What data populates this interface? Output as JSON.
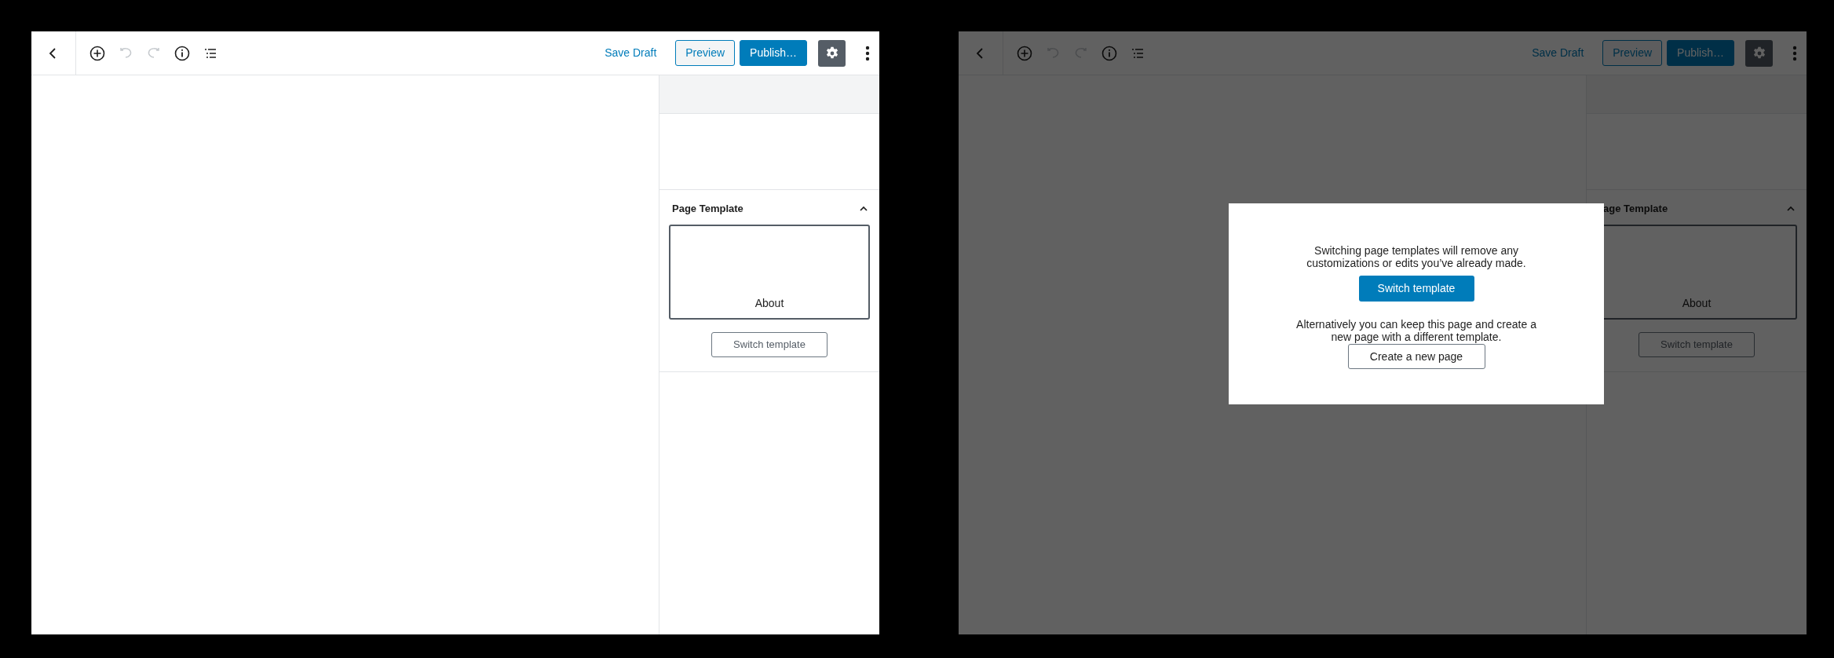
{
  "editors": [
    {
      "dimmed": false,
      "toolbar": {
        "tools": [
          {
            "kind": "back",
            "disabled": false
          },
          {
            "kind": "add",
            "disabled": false
          },
          {
            "kind": "undo",
            "disabled": true
          },
          {
            "kind": "redo",
            "disabled": true
          },
          {
            "kind": "info",
            "disabled": false
          },
          {
            "kind": "outline",
            "disabled": false
          }
        ],
        "save_draft": "Save Draft",
        "preview": "Preview",
        "publish": "Publish…",
        "settings": {
          "selected": true
        }
      },
      "sidebar": {
        "panel": {
          "title": "Page Template",
          "expanded": true,
          "template": {
            "label": "About",
            "selected": true
          },
          "switch_button": "Switch template"
        }
      }
    },
    {
      "dimmed": true,
      "toolbar": {
        "tools": [
          {
            "kind": "back",
            "disabled": false
          },
          {
            "kind": "add",
            "disabled": false
          },
          {
            "kind": "undo",
            "disabled": true
          },
          {
            "kind": "redo",
            "disabled": true
          },
          {
            "kind": "info",
            "disabled": false
          },
          {
            "kind": "outline",
            "disabled": false
          }
        ],
        "save_draft": "Save Draft",
        "preview": "Preview",
        "publish": "Publish…",
        "settings": {
          "selected": true
        }
      },
      "sidebar": {
        "panel": {
          "title": "age Template",
          "expanded": true,
          "template": {
            "label": "About",
            "selected": true
          },
          "switch_button": "Switch template"
        }
      },
      "dialog": {
        "message": "Switching page templates will remove any customizations or edits you’ve already made.",
        "confirm_button": "Switch template",
        "alternative": "Alternatively you can keep this page and create a new page with a different template.",
        "new_page_button": "Create a new page"
      }
    }
  ]
}
